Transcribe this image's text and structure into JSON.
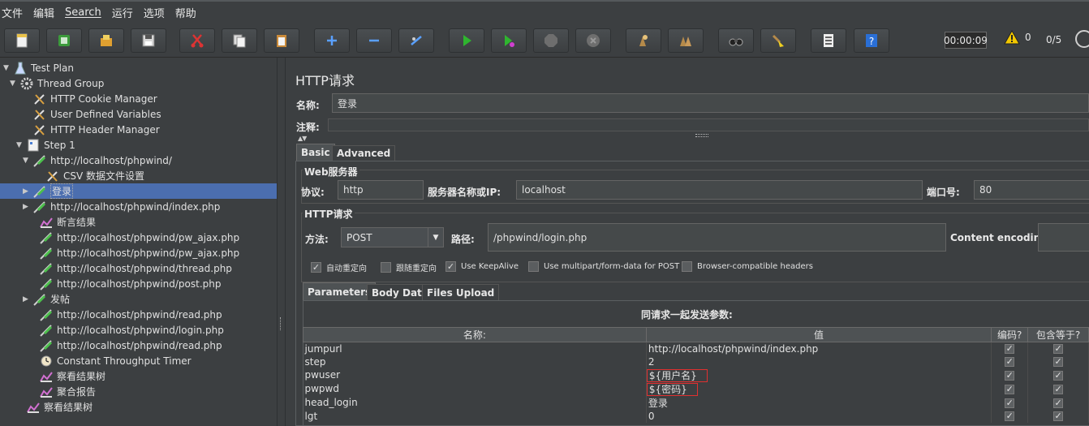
{
  "menu": [
    "文件",
    "编辑",
    "Search",
    "运行",
    "选项",
    "帮助"
  ],
  "toolbar": {
    "buttons": [
      "new-icon",
      "templates-icon",
      "open-icon",
      "save-icon",
      "cut-icon",
      "copy-icon",
      "paste-icon",
      "expand-icon",
      "collapse-icon",
      "toggle-icon",
      "start-icon",
      "start-no-pause-icon",
      "stop-icon",
      "shutdown-icon",
      "clear-icon",
      "clear-all-icon",
      "search-icon",
      "reset-search-icon",
      "function-helper-icon",
      "help-icon"
    ],
    "timer": "00:00:09",
    "warnings": "0",
    "threads": "0/5"
  },
  "tree": [
    {
      "label": "Test Plan",
      "icon": "test-plan-icon",
      "arrow": "▼"
    },
    {
      "label": "Thread Group",
      "icon": "gear-icon",
      "arrow": "▼"
    },
    {
      "label": "HTTP Cookie Manager",
      "icon": "wrench-icon",
      "arrow": ""
    },
    {
      "label": "User Defined Variables",
      "icon": "wrench-icon",
      "arrow": ""
    },
    {
      "label": "HTTP Header Manager",
      "icon": "wrench-icon",
      "arrow": ""
    },
    {
      "label": "Step 1",
      "icon": "controller-icon",
      "arrow": "▼"
    },
    {
      "label": "http://localhost/phpwind/",
      "icon": "sampler-icon",
      "arrow": "▼"
    },
    {
      "label": "CSV 数据文件设置",
      "icon": "wrench-icon",
      "arrow": ""
    },
    {
      "label": "登录",
      "icon": "sampler-icon",
      "arrow": "▶"
    },
    {
      "label": "http://localhost/phpwind/index.php",
      "icon": "sampler-icon",
      "arrow": "▶"
    },
    {
      "label": "断言结果",
      "icon": "listener-icon",
      "arrow": ""
    },
    {
      "label": "http://localhost/phpwind/pw_ajax.php",
      "icon": "sampler-icon",
      "arrow": ""
    },
    {
      "label": "http://localhost/phpwind/pw_ajax.php",
      "icon": "sampler-icon",
      "arrow": ""
    },
    {
      "label": "http://localhost/phpwind/thread.php",
      "icon": "sampler-icon",
      "arrow": ""
    },
    {
      "label": "http://localhost/phpwind/post.php",
      "icon": "sampler-icon",
      "arrow": ""
    },
    {
      "label": "发帖",
      "icon": "sampler-icon",
      "arrow": "▶"
    },
    {
      "label": "http://localhost/phpwind/read.php",
      "icon": "sampler-icon",
      "arrow": ""
    },
    {
      "label": "http://localhost/phpwind/login.php",
      "icon": "sampler-icon",
      "arrow": ""
    },
    {
      "label": "http://localhost/phpwind/read.php",
      "icon": "sampler-icon",
      "arrow": ""
    },
    {
      "label": "Constant Throughput Timer",
      "icon": "timer-icon",
      "arrow": ""
    },
    {
      "label": "察看结果树",
      "icon": "listener-icon",
      "arrow": ""
    },
    {
      "label": "聚合报告",
      "icon": "listener-icon",
      "arrow": ""
    },
    {
      "label": "察看结果树",
      "icon": "listener-icon",
      "arrow": ""
    }
  ],
  "panel": {
    "title": "HTTP请求",
    "name_label": "名称:",
    "name_value": "登录",
    "comment_label": "注释:",
    "tabs": [
      "Basic",
      "Advanced"
    ],
    "web_server": {
      "title": "Web服务器",
      "protocol_label": "协议:",
      "protocol": "http",
      "server_label": "服务器名称或IP:",
      "server": "localhost",
      "port_label": "端口号:",
      "port": "80"
    },
    "http_request": {
      "title": "HTTP请求",
      "method_label": "方法:",
      "method": "POST",
      "path_label": "路径:",
      "path": "/phpwind/login.php",
      "encoding_label": "Content encoding:"
    },
    "options": [
      {
        "label": "自动重定向",
        "checked": true
      },
      {
        "label": "跟随重定向",
        "checked": false
      },
      {
        "label": "Use KeepAlive",
        "checked": true
      },
      {
        "label": "Use multipart/form-data for POST",
        "checked": false
      },
      {
        "label": "Browser-compatible headers",
        "checked": false
      }
    ],
    "sub_tabs": [
      "Parameters",
      "Body Data",
      "Files Upload"
    ],
    "params_caption": "同请求一起发送参数:",
    "params_headers": [
      "名称:",
      "值",
      "编码?",
      "包含等于?"
    ],
    "params": [
      {
        "name": "jumpurl",
        "value": "http://localhost/phpwind/index.php"
      },
      {
        "name": "step",
        "value": "2"
      },
      {
        "name": "pwuser",
        "value": "${用户名}"
      },
      {
        "name": "pwpwd",
        "value": "${密码}"
      },
      {
        "name": "head_login",
        "value": "登录"
      },
      {
        "name": "lgt",
        "value": "0"
      }
    ]
  }
}
